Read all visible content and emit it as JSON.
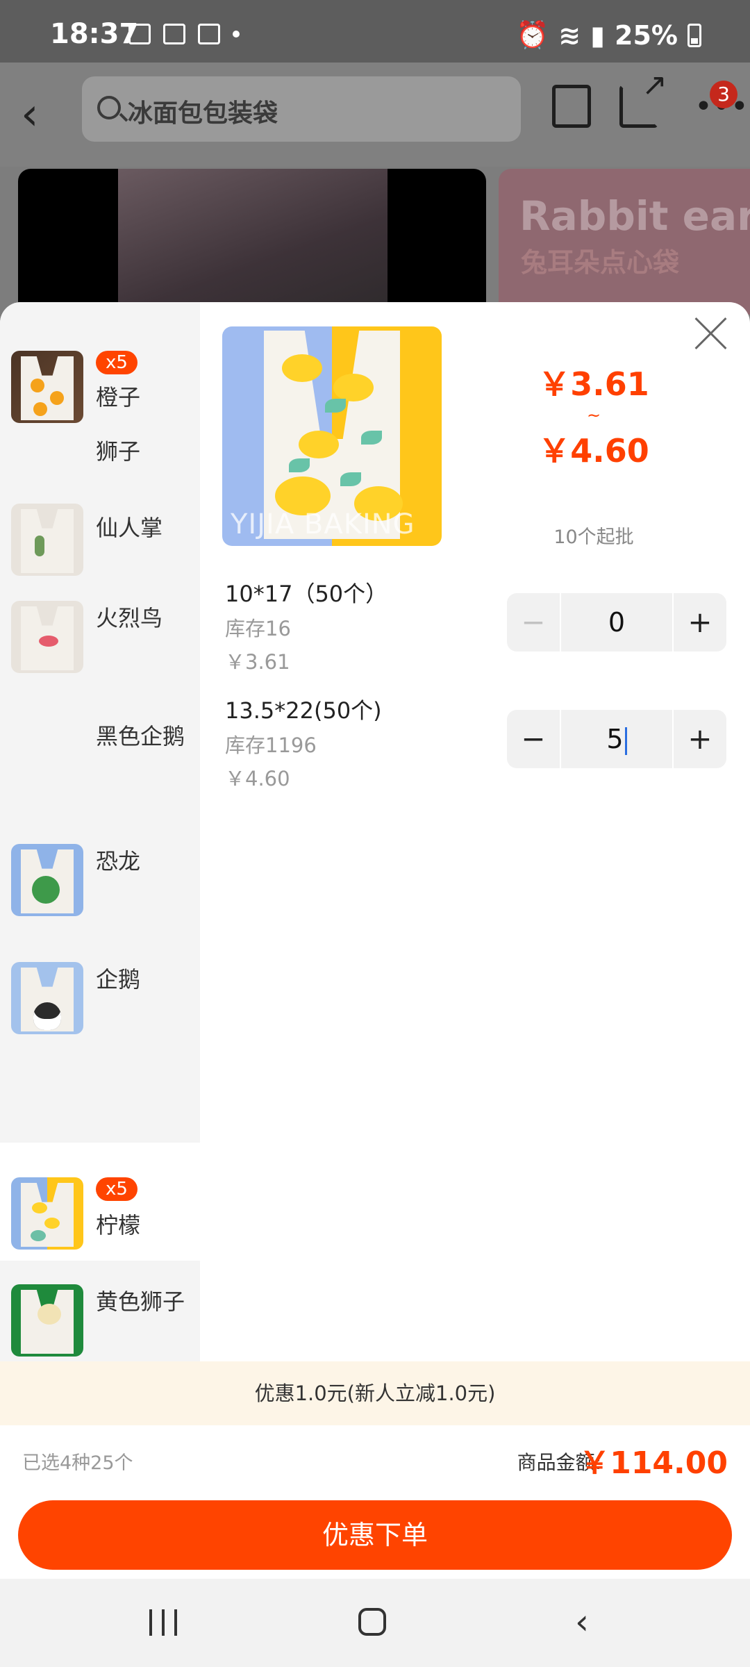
{
  "status_bar": {
    "time": "18:37",
    "battery": "25%"
  },
  "search": {
    "placeholder": "冰面包包装袋"
  },
  "cart": {
    "badge": "3"
  },
  "banner": {
    "title": "Rabbit ears",
    "subtitle": "兔耳朵点心袋"
  },
  "styles": [
    {
      "name": "橙子",
      "badge": "x5",
      "thumb": "orange",
      "selected": false
    },
    {
      "name": "狮子",
      "badge": "",
      "thumb": "",
      "selected": false
    },
    {
      "name": "仙人掌",
      "badge": "",
      "thumb": "cactus",
      "selected": false
    },
    {
      "name": "火烈鸟",
      "badge": "",
      "thumb": "bird",
      "selected": false
    },
    {
      "name": "黑色企鹅",
      "badge": "",
      "thumb": "",
      "selected": false
    },
    {
      "name": "恐龙",
      "badge": "",
      "thumb": "dino",
      "selected": false
    },
    {
      "name": "企鹅",
      "badge": "",
      "thumb": "penguin",
      "selected": false
    },
    {
      "name": "柠檬",
      "badge": "x5",
      "thumb": "lemon",
      "selected": true
    },
    {
      "name": "黄色狮子",
      "badge": "",
      "thumb": "lion",
      "selected": false
    }
  ],
  "product": {
    "watermark": "YIJIA BAKING",
    "price_low": "￥3.61",
    "price_sep": "~",
    "price_high": "￥4.60",
    "min_order": "10个起批"
  },
  "skus": [
    {
      "name": "10*17（50个）",
      "stock": "库存16",
      "price": "￥3.61",
      "qty": "0",
      "minus_disabled": true
    },
    {
      "name": "13.5*22(50个)",
      "stock": "库存1196",
      "price": "￥4.60",
      "qty": "5",
      "minus_disabled": false
    }
  ],
  "stepper": {
    "minus": "−",
    "plus": "+"
  },
  "footer": {
    "promo": "优惠1.0元(新人立减1.0元)",
    "selected_count": "已选4种25个",
    "total_label": "商品金额:",
    "total_value": "￥114.00",
    "order_button": "优惠下单"
  },
  "colors": {
    "accent": "#ff4400",
    "price": "#ff4000",
    "promo_bg": "#fdf5e7"
  },
  "icons": [
    "back-icon",
    "search-icon",
    "clipboard-icon",
    "share-icon",
    "more-icon",
    "close-icon",
    "minus-icon",
    "plus-icon",
    "recent-apps-icon",
    "home-icon",
    "nav-back-icon"
  ]
}
